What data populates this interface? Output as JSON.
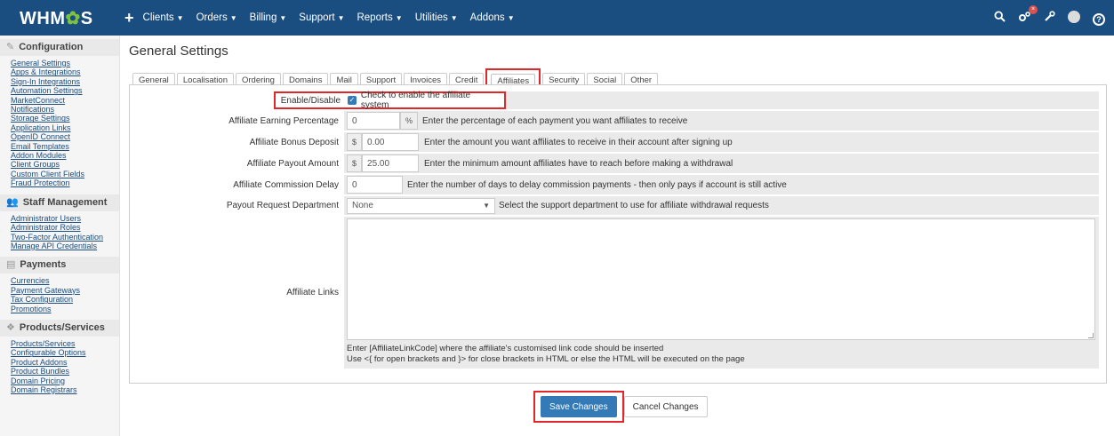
{
  "topbar": {
    "logo_text": "WHM",
    "logo_gear": "✿",
    "logo_tail": "S",
    "add_icon": "+",
    "nav": [
      {
        "label": "Clients"
      },
      {
        "label": "Orders"
      },
      {
        "label": "Billing"
      },
      {
        "label": "Support"
      },
      {
        "label": "Reports"
      },
      {
        "label": "Utilities"
      },
      {
        "label": "Addons"
      }
    ],
    "notification_badge": "×"
  },
  "sidebar": {
    "sections": [
      {
        "title": "Configuration",
        "icon": "wrench-icon",
        "links": [
          "General Settings",
          "Apps & Integrations",
          "Sign-In Integrations",
          "Automation Settings",
          "MarketConnect",
          "Notifications",
          "Storage Settings",
          "Application Links",
          "OpenID Connect",
          "Email Templates",
          "Addon Modules",
          "Client Groups",
          "Custom Client Fields",
          "Fraud Protection"
        ]
      },
      {
        "title": "Staff Management",
        "icon": "users-icon",
        "links": [
          "Administrator Users",
          "Administrator Roles",
          "Two-Factor Authentication",
          "Manage API Credentials"
        ]
      },
      {
        "title": "Payments",
        "icon": "money-icon",
        "links": [
          "Currencies",
          "Payment Gateways",
          "Tax Configuration",
          "Promotions"
        ]
      },
      {
        "title": "Products/Services",
        "icon": "cubes-icon",
        "links": [
          "Products/Services",
          "Configurable Options",
          "Product Addons",
          "Product Bundles",
          "Domain Pricing",
          "Domain Registrars"
        ]
      }
    ]
  },
  "main": {
    "title": "General Settings",
    "tabs": [
      "General",
      "Localisation",
      "Ordering",
      "Domains",
      "Mail",
      "Support",
      "Invoices",
      "Credit",
      "Affiliates",
      "Security",
      "Social",
      "Other"
    ],
    "active_tab": "Affiliates",
    "form": {
      "enable": {
        "label": "Enable/Disable",
        "checkbox_text": "Check to enable the affiliate system"
      },
      "earning_pct": {
        "label": "Affiliate Earning Percentage",
        "value": "0",
        "addon": "%",
        "help": "Enter the percentage of each payment you want affiliates to receive"
      },
      "bonus_deposit": {
        "label": "Affiliate Bonus Deposit",
        "addon": "$",
        "value": "0.00",
        "help": "Enter the amount you want affiliates to receive in their account after signing up"
      },
      "payout_amount": {
        "label": "Affiliate Payout Amount",
        "addon": "$",
        "value": "25.00",
        "help": "Enter the minimum amount affiliates have to reach before making a withdrawal"
      },
      "commission_delay": {
        "label": "Affiliate Commission Delay",
        "value": "0",
        "help": "Enter the number of days to delay commission payments - then only pays if account is still active"
      },
      "payout_dept": {
        "label": "Payout Request Department",
        "value": "None",
        "help": "Select the support department to use for affiliate withdrawal requests"
      },
      "links": {
        "label": "Affiliate Links",
        "help1": "Enter [AffiliateLinkCode] where the affiliate's customised link code should be inserted",
        "help2": "Use <{ for open brackets and }> for close brackets in HTML or else the HTML will be executed on the page"
      }
    },
    "buttons": {
      "save": "Save Changes",
      "cancel": "Cancel Changes"
    }
  }
}
